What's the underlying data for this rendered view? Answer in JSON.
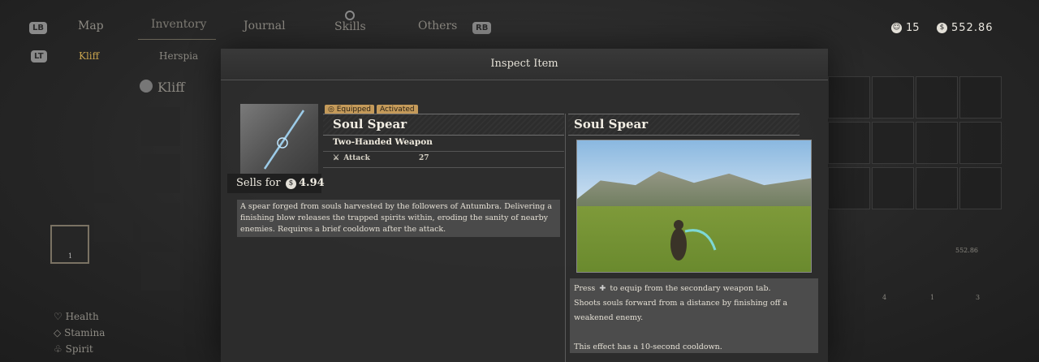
{
  "top_nav": {
    "lb_hint": "LB",
    "rb_hint": "RB",
    "lt_hint": "LT",
    "tabs": [
      "Map",
      "Inventory",
      "Journal",
      "Skills",
      "Others"
    ]
  },
  "currency": {
    "tokens": "15",
    "silver": "552.86"
  },
  "subtabs": [
    "Kliff",
    "Herspia"
  ],
  "character": {
    "name": "Kliff"
  },
  "stats": [
    "Health",
    "Stamina",
    "Spirit"
  ],
  "modal": {
    "title": "Inspect Item",
    "badges": [
      "Equipped",
      "Activated"
    ],
    "item_name": "Soul Spear",
    "item_type": "Two-Handed Weapon",
    "attack_label": "Attack",
    "attack_value": "27",
    "sells_label": "Sells for",
    "sells_value": "4.94",
    "description": "A spear forged from souls harvested by the followers of Antumbra. Delivering a finishing blow releases the trapped spirits within, eroding the sanity of nearby enemies. Requires a brief cooldown after the attack.",
    "preview_title": "Soul Spear",
    "tip_line1_pre": "Press",
    "tip_line1_post": "to equip from the secondary weapon tab.",
    "tip_line2": "Shoots souls forward from a distance by finishing off a weakened enemy.",
    "tip_line3": "This effect has a 10-second cooldown."
  },
  "grid_values": {
    "count_a": "4",
    "count_b": "1",
    "count_c": "3",
    "price": "552.86"
  },
  "slot_count": "1"
}
